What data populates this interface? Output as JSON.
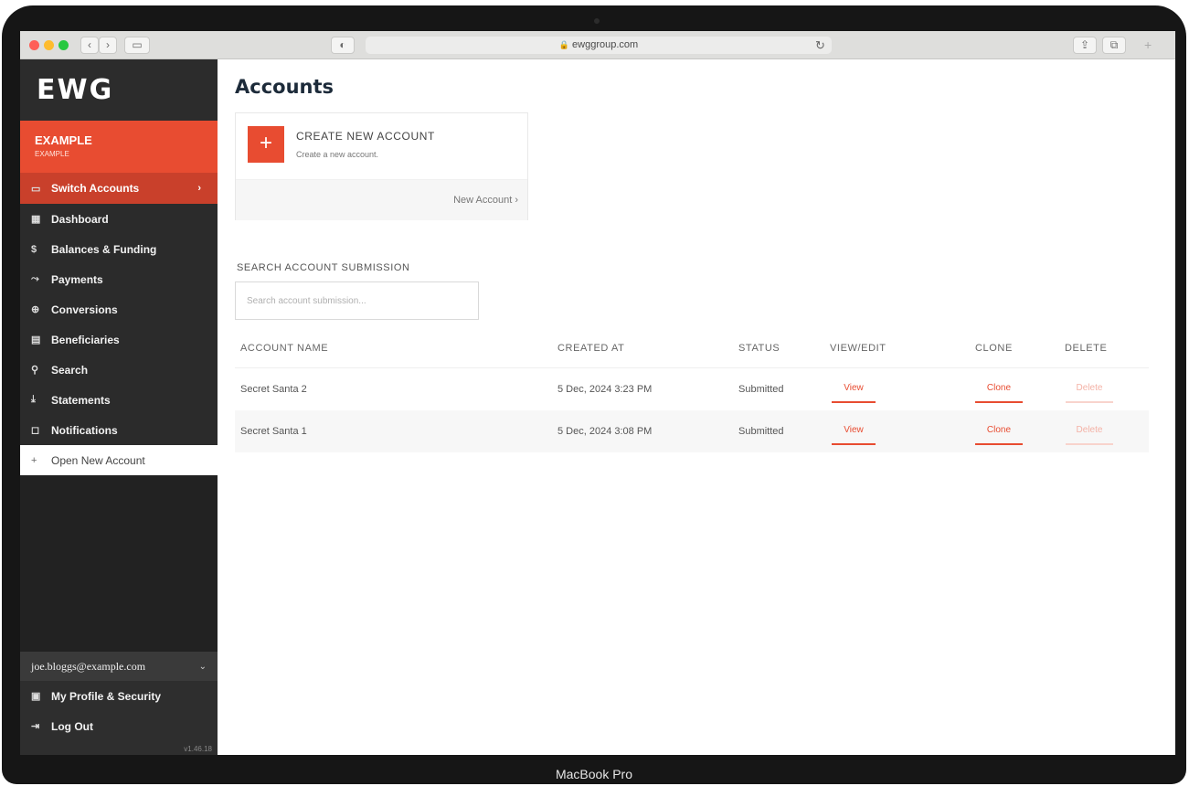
{
  "device": {
    "label": "MacBook Pro"
  },
  "browser": {
    "url": "ewggroup.com"
  },
  "sidebar": {
    "logo": "EWG",
    "account_name": "EXAMPLE",
    "account_sub": "EXAMPLE",
    "switch_label": "Switch Accounts",
    "items": [
      {
        "label": "Dashboard",
        "icon": "dashboard-icon"
      },
      {
        "label": "Balances & Funding",
        "icon": "dollar-icon"
      },
      {
        "label": "Payments",
        "icon": "payments-icon"
      },
      {
        "label": "Conversions",
        "icon": "globe-icon"
      },
      {
        "label": "Beneficiaries",
        "icon": "beneficiaries-icon"
      },
      {
        "label": "Search",
        "icon": "search-icon"
      },
      {
        "label": "Statements",
        "icon": "download-icon"
      },
      {
        "label": "Notifications",
        "icon": "bell-icon"
      }
    ],
    "open_new_label": "Open New Account",
    "user_email": "joe.bloggs@example.com",
    "profile_label": "My Profile & Security",
    "logout_label": "Log Out",
    "version": "v1.46.18"
  },
  "main": {
    "title": "Accounts",
    "create_card": {
      "title": "CREATE NEW ACCOUNT",
      "subtitle": "Create a new account.",
      "link": "New Account"
    },
    "search": {
      "label": "SEARCH ACCOUNT SUBMISSION",
      "placeholder": "Search account submission..."
    },
    "table": {
      "headers": {
        "name": "ACCOUNT NAME",
        "created": "CREATED AT",
        "status": "STATUS",
        "view": "VIEW/EDIT",
        "clone": "CLONE",
        "delete": "DELETE"
      },
      "rows": [
        {
          "name": "Secret Santa 2",
          "created": "5 Dec, 2024 3:23 PM",
          "status": "Submitted",
          "view": "View",
          "clone": "Clone",
          "delete": "Delete"
        },
        {
          "name": "Secret Santa 1",
          "created": "5 Dec, 2024 3:08 PM",
          "status": "Submitted",
          "view": "View",
          "clone": "Clone",
          "delete": "Delete"
        }
      ]
    }
  },
  "colors": {
    "accent": "#e84c31",
    "sidebar_bg": "#222222",
    "title": "#1d2b3a"
  }
}
